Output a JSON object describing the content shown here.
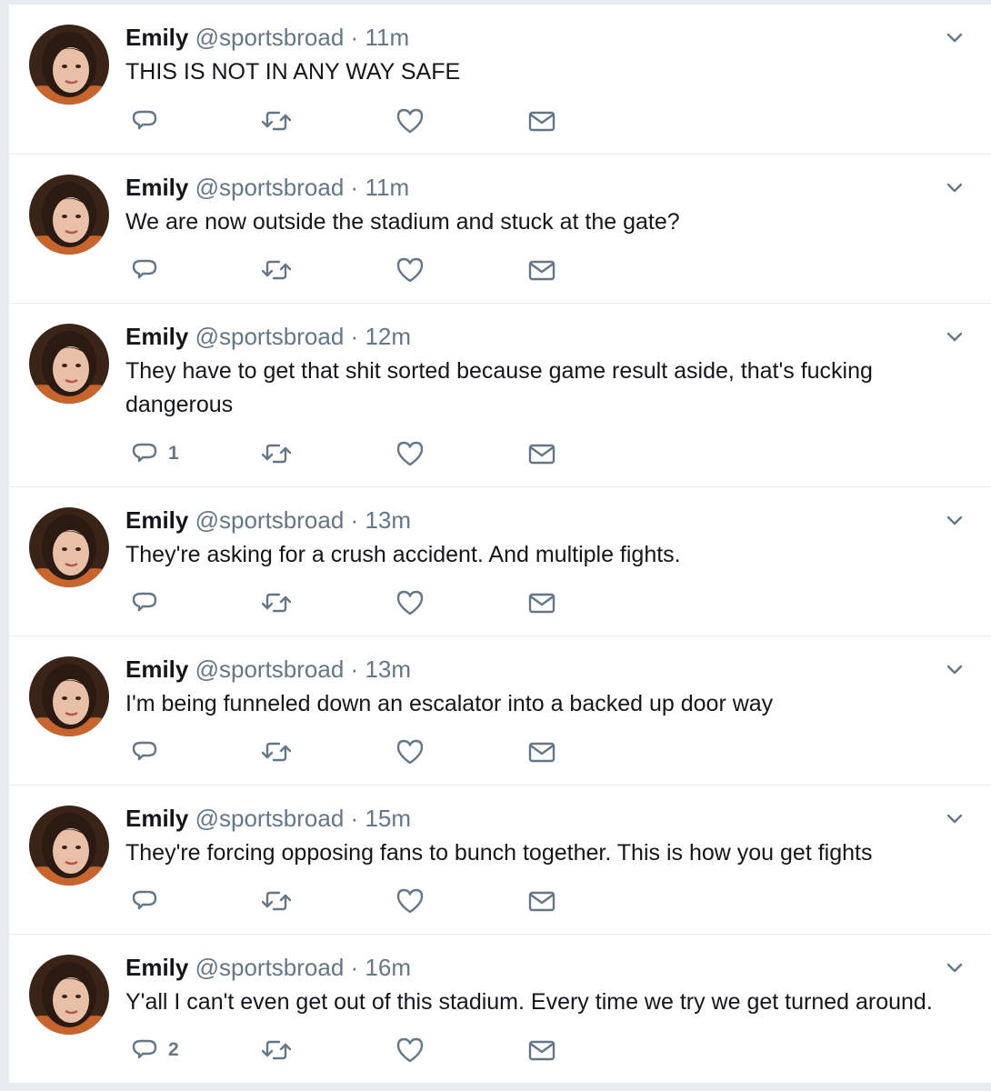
{
  "colors": {
    "name": "#14171a",
    "secondary": "#657786",
    "divider": "#e6ecf0",
    "background": "#ffffff"
  },
  "icons": [
    "caret-down-icon",
    "reply-icon",
    "retweet-icon",
    "heart-icon",
    "envelope-icon"
  ],
  "tweets": [
    {
      "name": "Emily",
      "handle": "@sportsbroad",
      "dot": "·",
      "time": "11m",
      "text": "THIS IS NOT IN ANY WAY SAFE",
      "reply_count": ""
    },
    {
      "name": "Emily",
      "handle": "@sportsbroad",
      "dot": "·",
      "time": "11m",
      "text": "We are now outside the stadium and stuck at the gate?",
      "reply_count": ""
    },
    {
      "name": "Emily",
      "handle": "@sportsbroad",
      "dot": "·",
      "time": "12m",
      "text": "They have to get that shit sorted because game result aside, that's fucking dangerous",
      "reply_count": "1"
    },
    {
      "name": "Emily",
      "handle": "@sportsbroad",
      "dot": "·",
      "time": "13m",
      "text": "They're asking for a crush accident. And multiple fights.",
      "reply_count": ""
    },
    {
      "name": "Emily",
      "handle": "@sportsbroad",
      "dot": "·",
      "time": "13m",
      "text": "I'm being funneled down an escalator into a backed up door way",
      "reply_count": ""
    },
    {
      "name": "Emily",
      "handle": "@sportsbroad",
      "dot": "·",
      "time": "15m",
      "text": "They're forcing opposing fans to bunch together. This is how you get fights",
      "reply_count": ""
    },
    {
      "name": "Emily",
      "handle": "@sportsbroad",
      "dot": "·",
      "time": "16m",
      "text": "Y'all I can't even get out of this stadium. Every time we try we get turned around.",
      "reply_count": "2"
    }
  ]
}
